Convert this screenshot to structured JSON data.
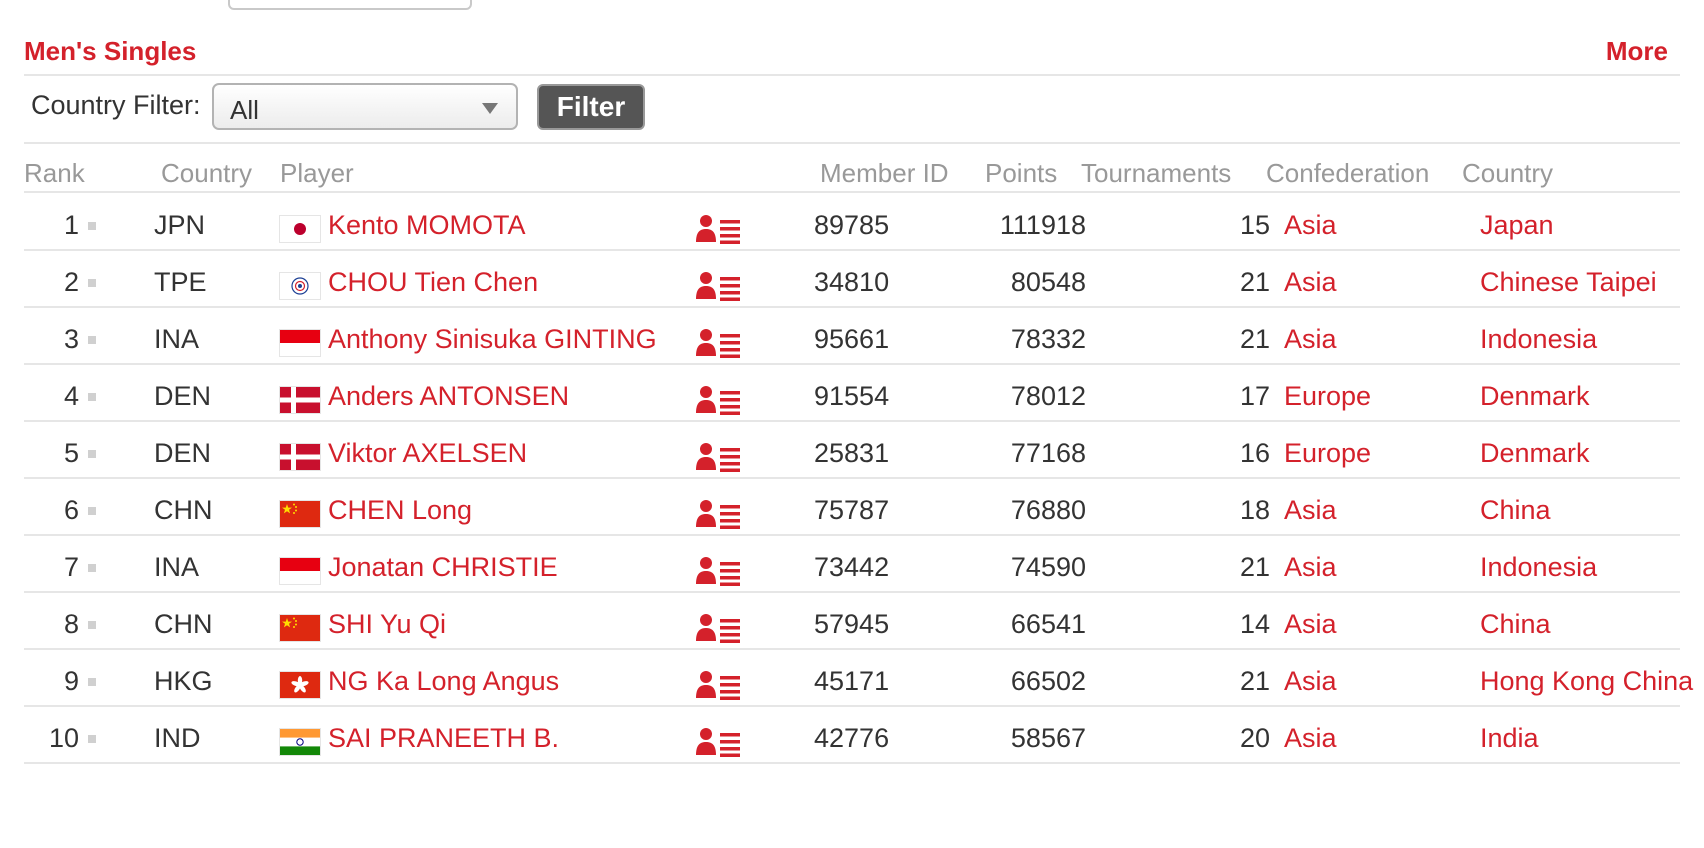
{
  "section": {
    "title": "Men's Singles",
    "more_label": "More"
  },
  "filter": {
    "label": "Country Filter:",
    "selected": "All",
    "button_label": "Filter"
  },
  "table": {
    "headers": {
      "rank": "Rank",
      "country_code": "Country",
      "player": "Player",
      "member_id": "Member ID",
      "points": "Points",
      "tournaments": "Tournaments",
      "confederation": "Confederation",
      "country": "Country"
    },
    "rows": [
      {
        "rank": "1",
        "code": "JPN",
        "flag": "japan-flag",
        "player": "Kento MOMOTA",
        "member_id": "89785",
        "points": "111918",
        "tournaments": "15",
        "confederation": "Asia",
        "country": "Japan"
      },
      {
        "rank": "2",
        "code": "TPE",
        "flag": "chinese-taipei-flag",
        "player": "CHOU Tien Chen",
        "member_id": "34810",
        "points": "80548",
        "tournaments": "21",
        "confederation": "Asia",
        "country": "Chinese Taipei"
      },
      {
        "rank": "3",
        "code": "INA",
        "flag": "indonesia-flag",
        "player": "Anthony Sinisuka GINTING",
        "member_id": "95661",
        "points": "78332",
        "tournaments": "21",
        "confederation": "Asia",
        "country": "Indonesia"
      },
      {
        "rank": "4",
        "code": "DEN",
        "flag": "denmark-flag",
        "player": "Anders ANTONSEN",
        "member_id": "91554",
        "points": "78012",
        "tournaments": "17",
        "confederation": "Europe",
        "country": "Denmark"
      },
      {
        "rank": "5",
        "code": "DEN",
        "flag": "denmark-flag",
        "player": "Viktor AXELSEN",
        "member_id": "25831",
        "points": "77168",
        "tournaments": "16",
        "confederation": "Europe",
        "country": "Denmark"
      },
      {
        "rank": "6",
        "code": "CHN",
        "flag": "china-flag",
        "player": "CHEN Long",
        "member_id": "75787",
        "points": "76880",
        "tournaments": "18",
        "confederation": "Asia",
        "country": "China"
      },
      {
        "rank": "7",
        "code": "INA",
        "flag": "indonesia-flag",
        "player": "Jonatan CHRISTIE",
        "member_id": "73442",
        "points": "74590",
        "tournaments": "21",
        "confederation": "Asia",
        "country": "Indonesia"
      },
      {
        "rank": "8",
        "code": "CHN",
        "flag": "china-flag",
        "player": "SHI Yu Qi",
        "member_id": "57945",
        "points": "66541",
        "tournaments": "14",
        "confederation": "Asia",
        "country": "China"
      },
      {
        "rank": "9",
        "code": "HKG",
        "flag": "hong-kong-flag",
        "player": "NG Ka Long Angus",
        "member_id": "45171",
        "points": "66502",
        "tournaments": "21",
        "confederation": "Asia",
        "country": "Hong Kong China"
      },
      {
        "rank": "10",
        "code": "IND",
        "flag": "india-flag",
        "player": "SAI PRANEETH B.",
        "member_id": "42776",
        "points": "58567",
        "tournaments": "20",
        "confederation": "Asia",
        "country": "India"
      }
    ]
  },
  "icons": {
    "rank_marker": "square-dot-icon",
    "player_card": "player-profile-icon"
  },
  "colors": {
    "accent": "#d4212b",
    "header_text": "#999999",
    "body_text": "#333333",
    "rule": "#e6e6e6",
    "button_bg": "#555555"
  }
}
